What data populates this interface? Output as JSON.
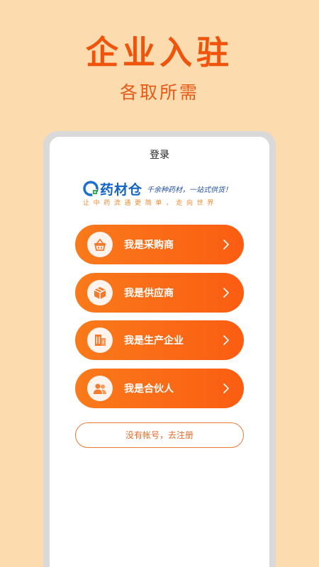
{
  "hero": {
    "title": "企业入驻",
    "subtitle": "各取所需"
  },
  "screen": {
    "title": "登录",
    "logo": {
      "name": "药材仓",
      "slogan": "千余种药材，一站式供货！",
      "tagline": "让中药流通更简单，走向世界"
    },
    "roles": [
      {
        "label": "我是采购商",
        "icon": "basket-icon"
      },
      {
        "label": "我是供应商",
        "icon": "package-icon"
      },
      {
        "label": "我是生产企业",
        "icon": "building-icon"
      },
      {
        "label": "我是合伙人",
        "icon": "partners-icon"
      }
    ],
    "register_label": "没有帐号，去注册"
  },
  "colors": {
    "background": "#fcdcae",
    "accent": "#f0530c",
    "button_gradient_start": "#f97a1b",
    "button_gradient_end": "#fb5d12",
    "brand_blue": "#1464c8"
  }
}
